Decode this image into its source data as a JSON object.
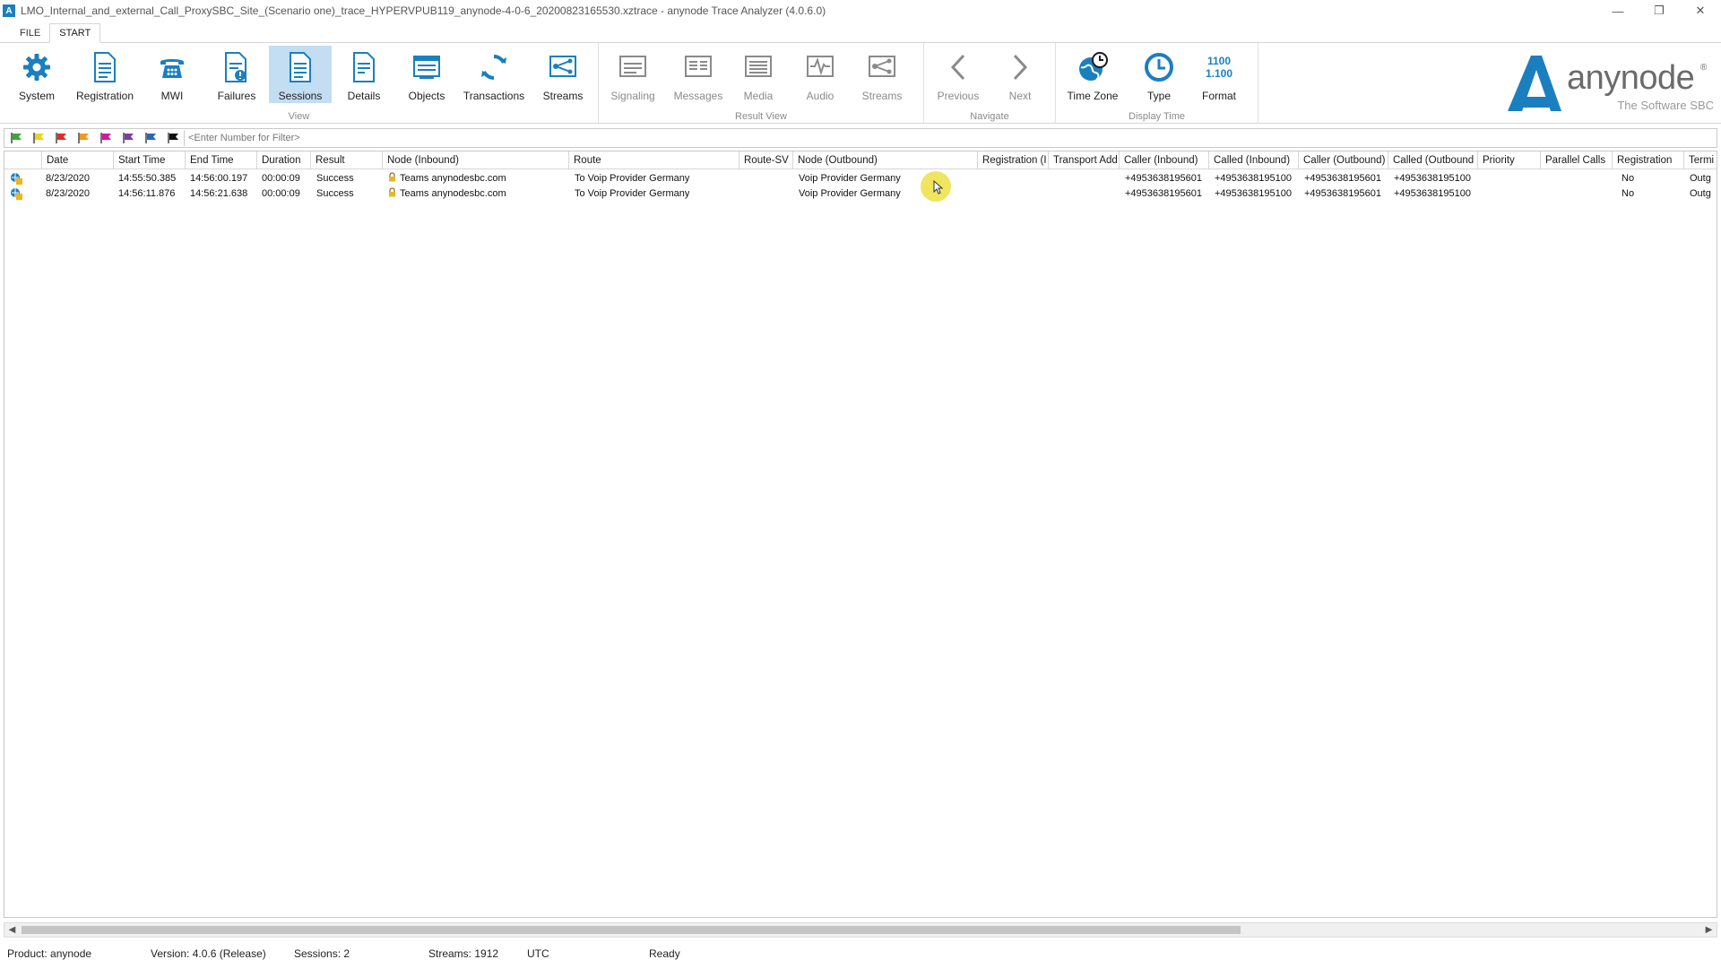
{
  "window": {
    "title": "LMO_Internal_and_external_Call_ProxySBC_Site_(Scenario one)_trace_HYPERVPUB119_anynode-4-0-6_20200823165530.xztrace - anynode Trace Analyzer (4.0.6.0)",
    "controls": [
      "—",
      "❐",
      "✕"
    ]
  },
  "ribbon_tabs": [
    "FILE",
    "START"
  ],
  "groups": {
    "view": {
      "label": "View",
      "buttons": [
        "System",
        "Registration",
        "MWI",
        "Failures",
        "Sessions",
        "Details",
        "Objects",
        "Transactions",
        "Streams"
      ]
    },
    "result_view": {
      "label": "Result View",
      "buttons": [
        "Signaling",
        "Messages",
        "Media",
        "Audio",
        "Streams"
      ]
    },
    "navigate": {
      "label": "Navigate",
      "buttons": [
        "Previous",
        "Next"
      ]
    },
    "display_time": {
      "label": "Display Time",
      "buttons": [
        "Time Zone",
        "Type",
        "Format"
      ],
      "format_icon_line1": "1100",
      "format_icon_line2": "1.100"
    }
  },
  "brand": {
    "name": "anynode",
    "reg": "®",
    "tagline": "The Software SBC",
    "color": "#1b7fbf"
  },
  "filter": {
    "placeholder": "<Enter Number for Filter>",
    "flag_colors": [
      "#3aa935",
      "#f0d21c",
      "#e22b2b",
      "#f39a1d",
      "#d6189c",
      "#7a3fa6",
      "#2b63c4",
      "#111111"
    ]
  },
  "table": {
    "columns": [
      "",
      "Date",
      "Start Time",
      "End Time",
      "Duration",
      "Result",
      "Node (Inbound)",
      "Route",
      "Route-SV",
      "Node (Outbound)",
      "Registration (I",
      "Transport Add",
      "Caller (Inbound)",
      "Called (Inbound)",
      "Caller (Outbound)",
      "Called (Outbound",
      "Priority",
      "Parallel Calls",
      "Registration",
      "Termi"
    ],
    "rows": [
      [
        "",
        "8/23/2020",
        "14:55:50.385",
        "14:56:00.197",
        "00:00:09",
        "Success",
        "Teams anynodesbc.com",
        "To Voip Provider Germany",
        "",
        "Voip Provider Germany",
        "",
        "",
        "+4953638195601",
        "+4953638195100",
        "+4953638195601",
        "+4953638195100",
        "",
        "",
        "No",
        "Outg"
      ],
      [
        "",
        "8/23/2020",
        "14:56:11.876",
        "14:56:21.638",
        "00:00:09",
        "Success",
        "Teams anynodesbc.com",
        "To Voip Provider Germany",
        "",
        "Voip Provider Germany",
        "",
        "",
        "+4953638195601",
        "+4953638195100",
        "+4953638195601",
        "+4953638195100",
        "",
        "",
        "No",
        "Outg"
      ]
    ]
  },
  "status": {
    "product": "Product: anynode",
    "version": "Version: 4.0.6 (Release)",
    "sessions": "Sessions: 2",
    "streams": "Streams: 1912",
    "timezone": "UTC",
    "state": "Ready"
  }
}
